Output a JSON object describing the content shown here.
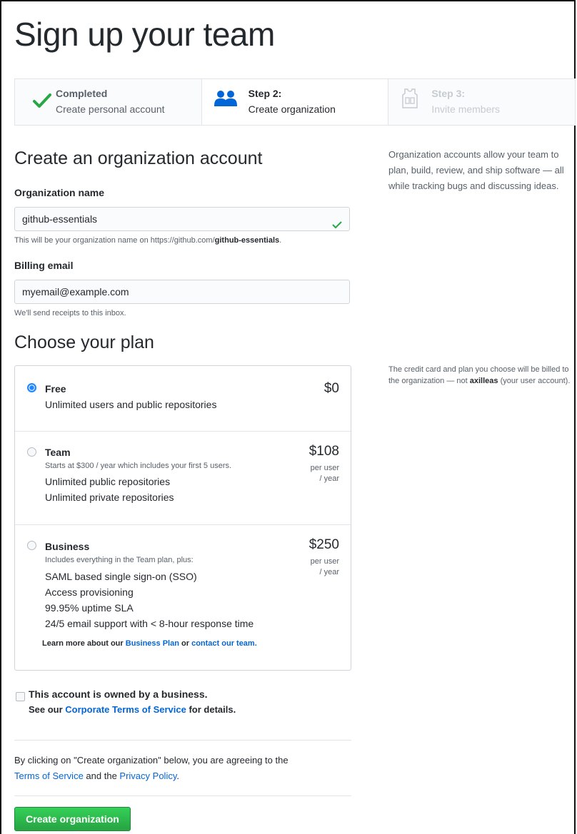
{
  "page": {
    "title": "Sign up your team"
  },
  "steps": [
    {
      "line1": "Completed",
      "line2": "Create personal account",
      "icon": "check-icon",
      "state": "done"
    },
    {
      "line1": "Step 2:",
      "line2": "Create organization",
      "icon": "people-icon",
      "state": "current"
    },
    {
      "line1": "Step 3:",
      "line2": "Invite members",
      "icon": "jersey-icon",
      "state": "future"
    }
  ],
  "org": {
    "heading": "Create an organization account",
    "name_label": "Organization name",
    "name_value": "github-essentials",
    "name_note_prefix": "This will be your organization name on https://github.com/",
    "name_note_bold": "github-essentials",
    "name_note_suffix": ".",
    "email_label": "Billing email",
    "email_value": "myemail@example.com",
    "email_note": "We'll send receipts to this inbox.",
    "side_text": "Organization accounts allow your team to plan, build, review, and ship software — all while tracking bugs and discussing ideas."
  },
  "plan": {
    "heading": "Choose your plan",
    "side_prefix": "The credit card and plan you choose will be billed to the organization — not ",
    "side_bold": "axilleas",
    "side_suffix": " (your user account).",
    "options": [
      {
        "name": "Free",
        "price": "$0",
        "selected": true,
        "features": [
          "Unlimited users and public repositories"
        ]
      },
      {
        "name": "Team",
        "price": "$108",
        "per1": "per user",
        "per2": "/ year",
        "selected": false,
        "desc": "Starts at $300 / year which includes your first 5 users.",
        "features": [
          "Unlimited public repositories",
          "Unlimited private repositories"
        ]
      },
      {
        "name": "Business",
        "price": "$250",
        "per1": "per user",
        "per2": "/ year",
        "selected": false,
        "desc": "Includes everything in the Team plan, plus:",
        "features": [
          "SAML based single sign-on (SSO)",
          "Access provisioning",
          "99.95% uptime SLA",
          "24/5 email support with < 8-hour response time"
        ]
      }
    ],
    "learn_prefix": "Learn more about our ",
    "learn_link1": "Business Plan",
    "learn_mid": " or ",
    "learn_link2": "contact our team."
  },
  "business": {
    "line1": "This account is owned by a business.",
    "line2_prefix": "See our ",
    "line2_link": "Corporate Terms of Service",
    "line2_suffix": " for details."
  },
  "agree": {
    "text": "By clicking on \"Create organization\" below, you are agreeing to the",
    "link1": "Terms of Service",
    "mid": " and the ",
    "link2": "Privacy Policy",
    "end": "."
  },
  "create_button": "Create organization",
  "colors": {
    "link": "#0366d6",
    "primary": "#28a745",
    "check": "#28a745",
    "people": "#0366d6"
  }
}
